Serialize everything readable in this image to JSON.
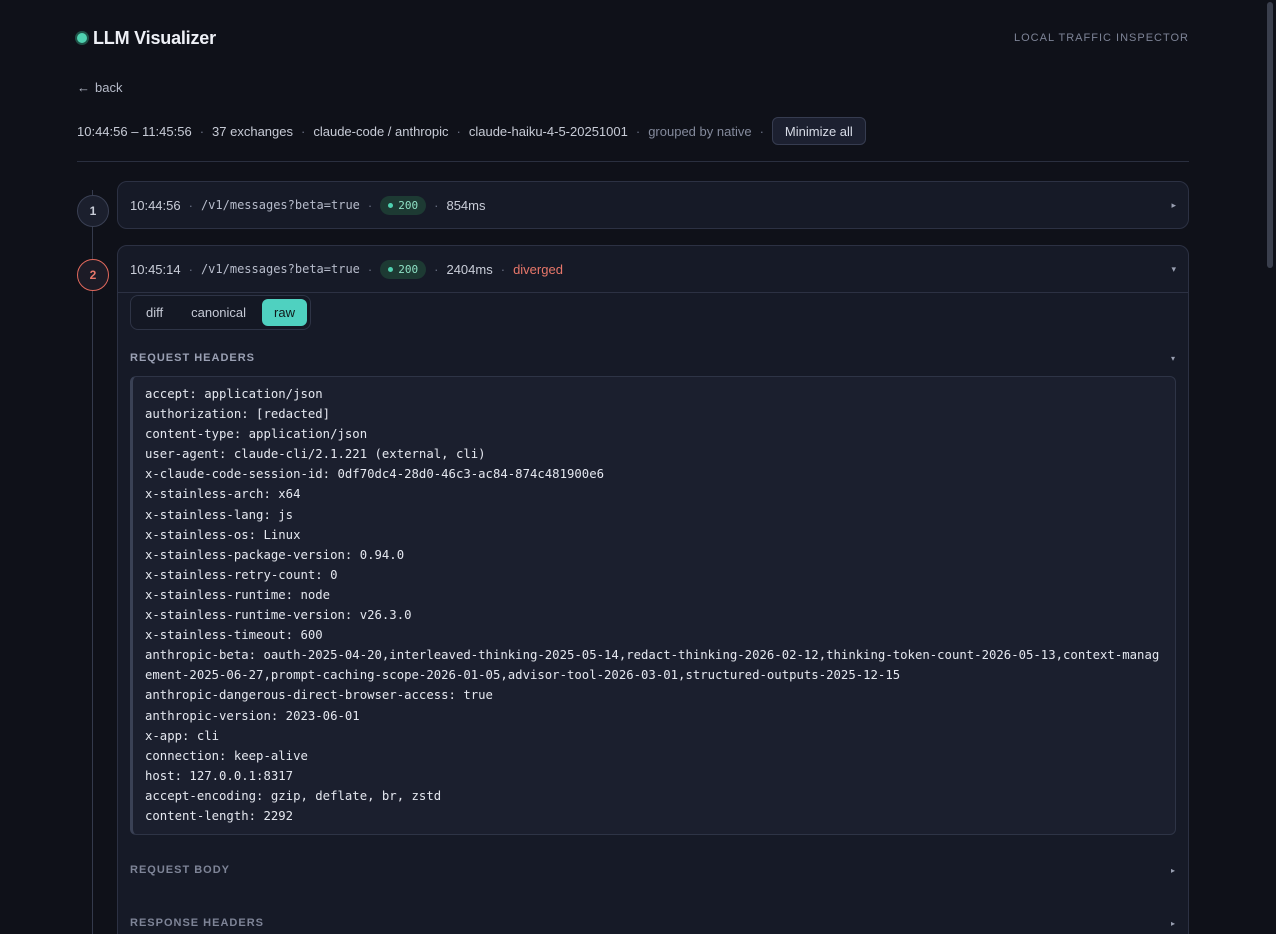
{
  "header": {
    "title": "LLM Visualizer",
    "tag": "LOCAL TRAFFIC INSPECTOR"
  },
  "nav": {
    "back_label": "back"
  },
  "meta": {
    "time_range": "10:44:56 – 11:45:56",
    "exchanges": "37 exchanges",
    "client": "claude-code / anthropic",
    "model": "claude-haiku-4-5-20251001",
    "grouping": "grouped by native",
    "minimize_label": "Minimize all"
  },
  "exchanges": [
    {
      "index": "1",
      "time": "10:44:56",
      "path": "/v1/messages?beta=true",
      "status": "200",
      "duration": "854ms"
    },
    {
      "index": "2",
      "time": "10:45:14",
      "path": "/v1/messages?beta=true",
      "status": "200",
      "duration": "2404ms",
      "flag": "diverged",
      "tabs": [
        "diff",
        "canonical",
        "raw"
      ],
      "active_tab": "raw",
      "sections": {
        "request_headers": "REQUEST HEADERS",
        "request_body": "REQUEST BODY",
        "response_headers": "RESPONSE HEADERS"
      },
      "request_headers": [
        "accept: application/json",
        "authorization: [redacted]",
        "content-type: application/json",
        "user-agent: claude-cli/2.1.221 (external, cli)",
        "x-claude-code-session-id: 0df70dc4-28d0-46c3-ac84-874c481900e6",
        "x-stainless-arch: x64",
        "x-stainless-lang: js",
        "x-stainless-os: Linux",
        "x-stainless-package-version: 0.94.0",
        "x-stainless-retry-count: 0",
        "x-stainless-runtime: node",
        "x-stainless-runtime-version: v26.3.0",
        "x-stainless-timeout: 600",
        "anthropic-beta: oauth-2025-04-20,interleaved-thinking-2025-05-14,redact-thinking-2026-02-12,thinking-token-count-2026-05-13,context-management-2025-06-27,prompt-caching-scope-2026-01-05,advisor-tool-2026-03-01,structured-outputs-2025-12-15",
        "anthropic-dangerous-direct-browser-access: true",
        "anthropic-version: 2023-06-01",
        "x-app: cli",
        "connection: keep-alive",
        "host: 127.0.0.1:8317",
        "accept-encoding: gzip, deflate, br, zstd",
        "content-length: 2292"
      ]
    }
  ],
  "colors": {
    "accent": "#4fd1c0",
    "diverged": "#e8776a",
    "status_ok": "#8ee0c4",
    "background": "#0f1119"
  },
  "icons": {
    "back": "arrow-left-icon",
    "collapsed": "caret-right-icon",
    "expanded": "caret-down-icon"
  }
}
